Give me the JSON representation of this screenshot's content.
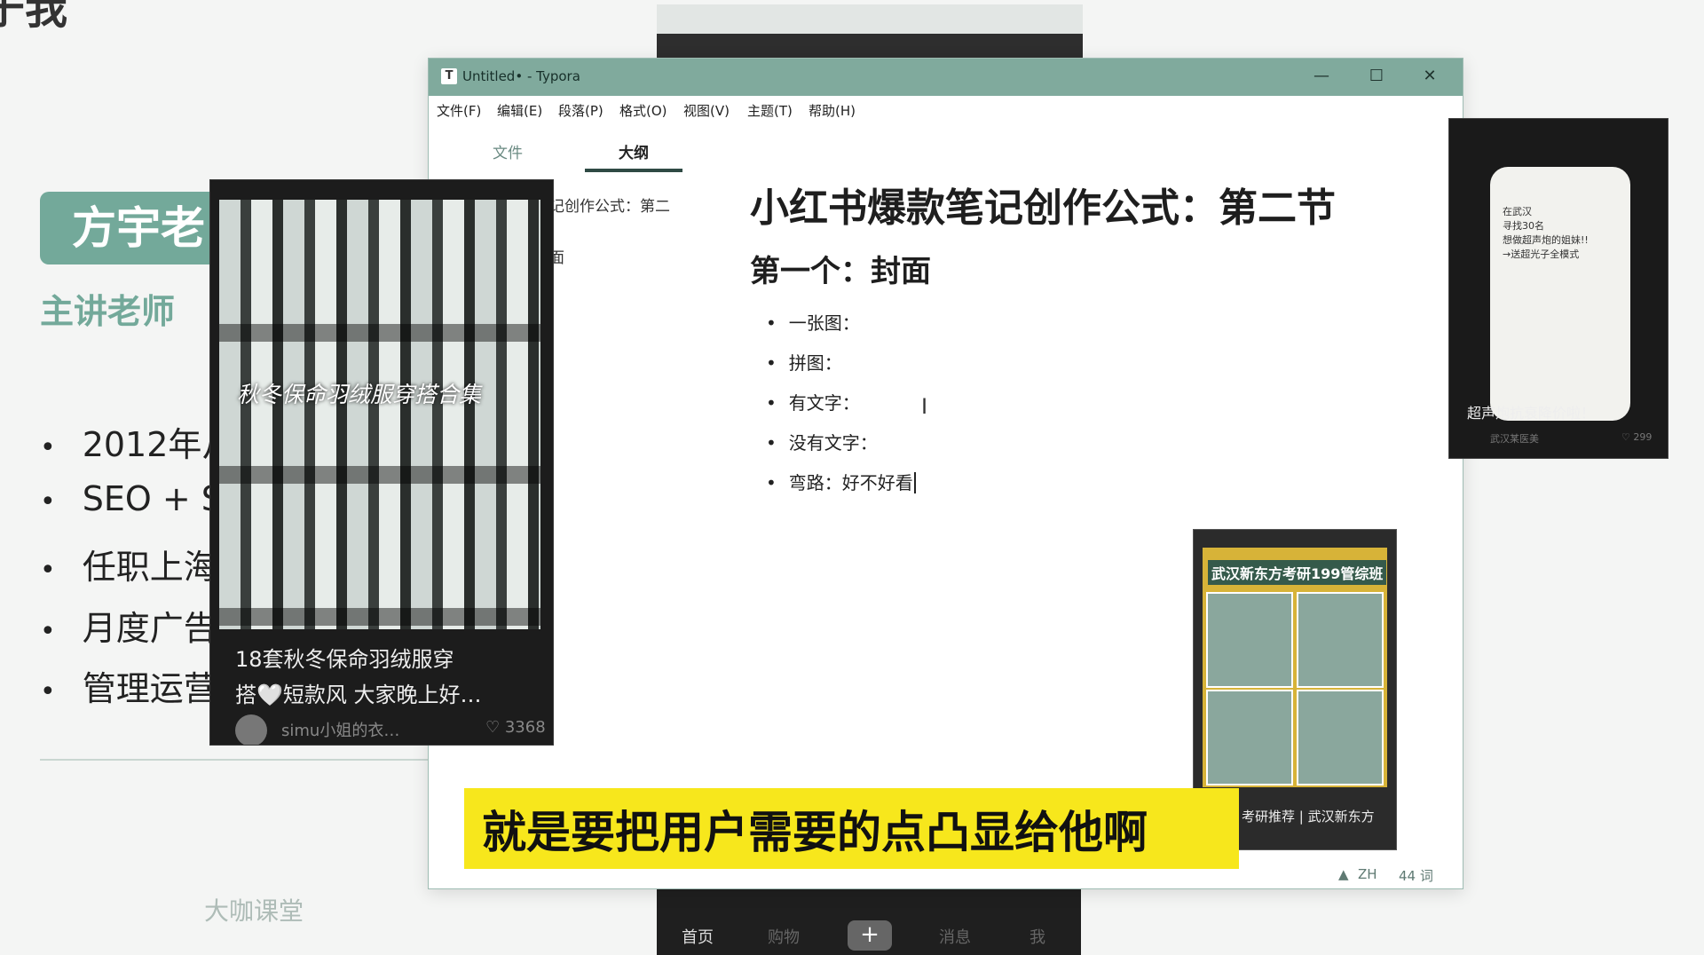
{
  "slide": {
    "heading": "于我",
    "teacher_name": "方宇老",
    "teacher_role": "主讲老师",
    "bullets": [
      "2012年从",
      "SEO + S",
      "任职上海",
      "月度广告",
      "管理运营"
    ],
    "logo": "大咖课堂"
  },
  "bottom_phone": {
    "tabs": [
      "首页",
      "购物",
      "+",
      "消息",
      "我"
    ]
  },
  "typora": {
    "title": "Untitled• - Typora",
    "app_icon": "T",
    "window_controls": {
      "minimize": "—",
      "maximize": "☐",
      "close": "✕"
    },
    "menu": [
      "文件(F)",
      "编辑(E)",
      "段落(P)",
      "格式(O)",
      "视图(V)",
      "主题(T)",
      "帮助(H)"
    ],
    "sidebar_tabs": [
      "文件",
      "大纲"
    ],
    "active_sidebar_tab": "大纲",
    "outline": [
      "记创作公式：第二",
      "面"
    ],
    "document": {
      "title": "小红书爆款笔记创作公式：第二节",
      "subtitle": "第一个：封面",
      "items": [
        "一张图：",
        "拼图：",
        "有文字：",
        "没有文字：",
        "弯路：好不好看"
      ]
    },
    "status": {
      "language": "ZH",
      "word_count": "44 词"
    }
  },
  "overlays": {
    "xhs_card": {
      "cover_text": "秋冬保命羽绒服穿搭合集",
      "caption_line1": "18套秋冬保命羽绒服穿",
      "caption_line2": "搭🤍短款风 大家晚上好…",
      "author": "simu小姐的衣…",
      "likes": "3368"
    },
    "phone_card": {
      "notes": [
        "在武汉",
        "寻找30名",
        "想做超声炮的姐妹!!",
        "→送超光子全模式"
      ],
      "caption": "超声炮抗衰降价啦！",
      "author": "武汉某医美",
      "likes": "299"
    },
    "ad_card": {
      "title": "武汉新东方考研199管综班",
      "caption": "考研推荐 | 武汉新东方"
    }
  },
  "subtitle": "就是要把用户需要的点凸显给他啊",
  "colors": {
    "accent": "#80aa9d",
    "subtitle_bg": "#f7e71c"
  }
}
